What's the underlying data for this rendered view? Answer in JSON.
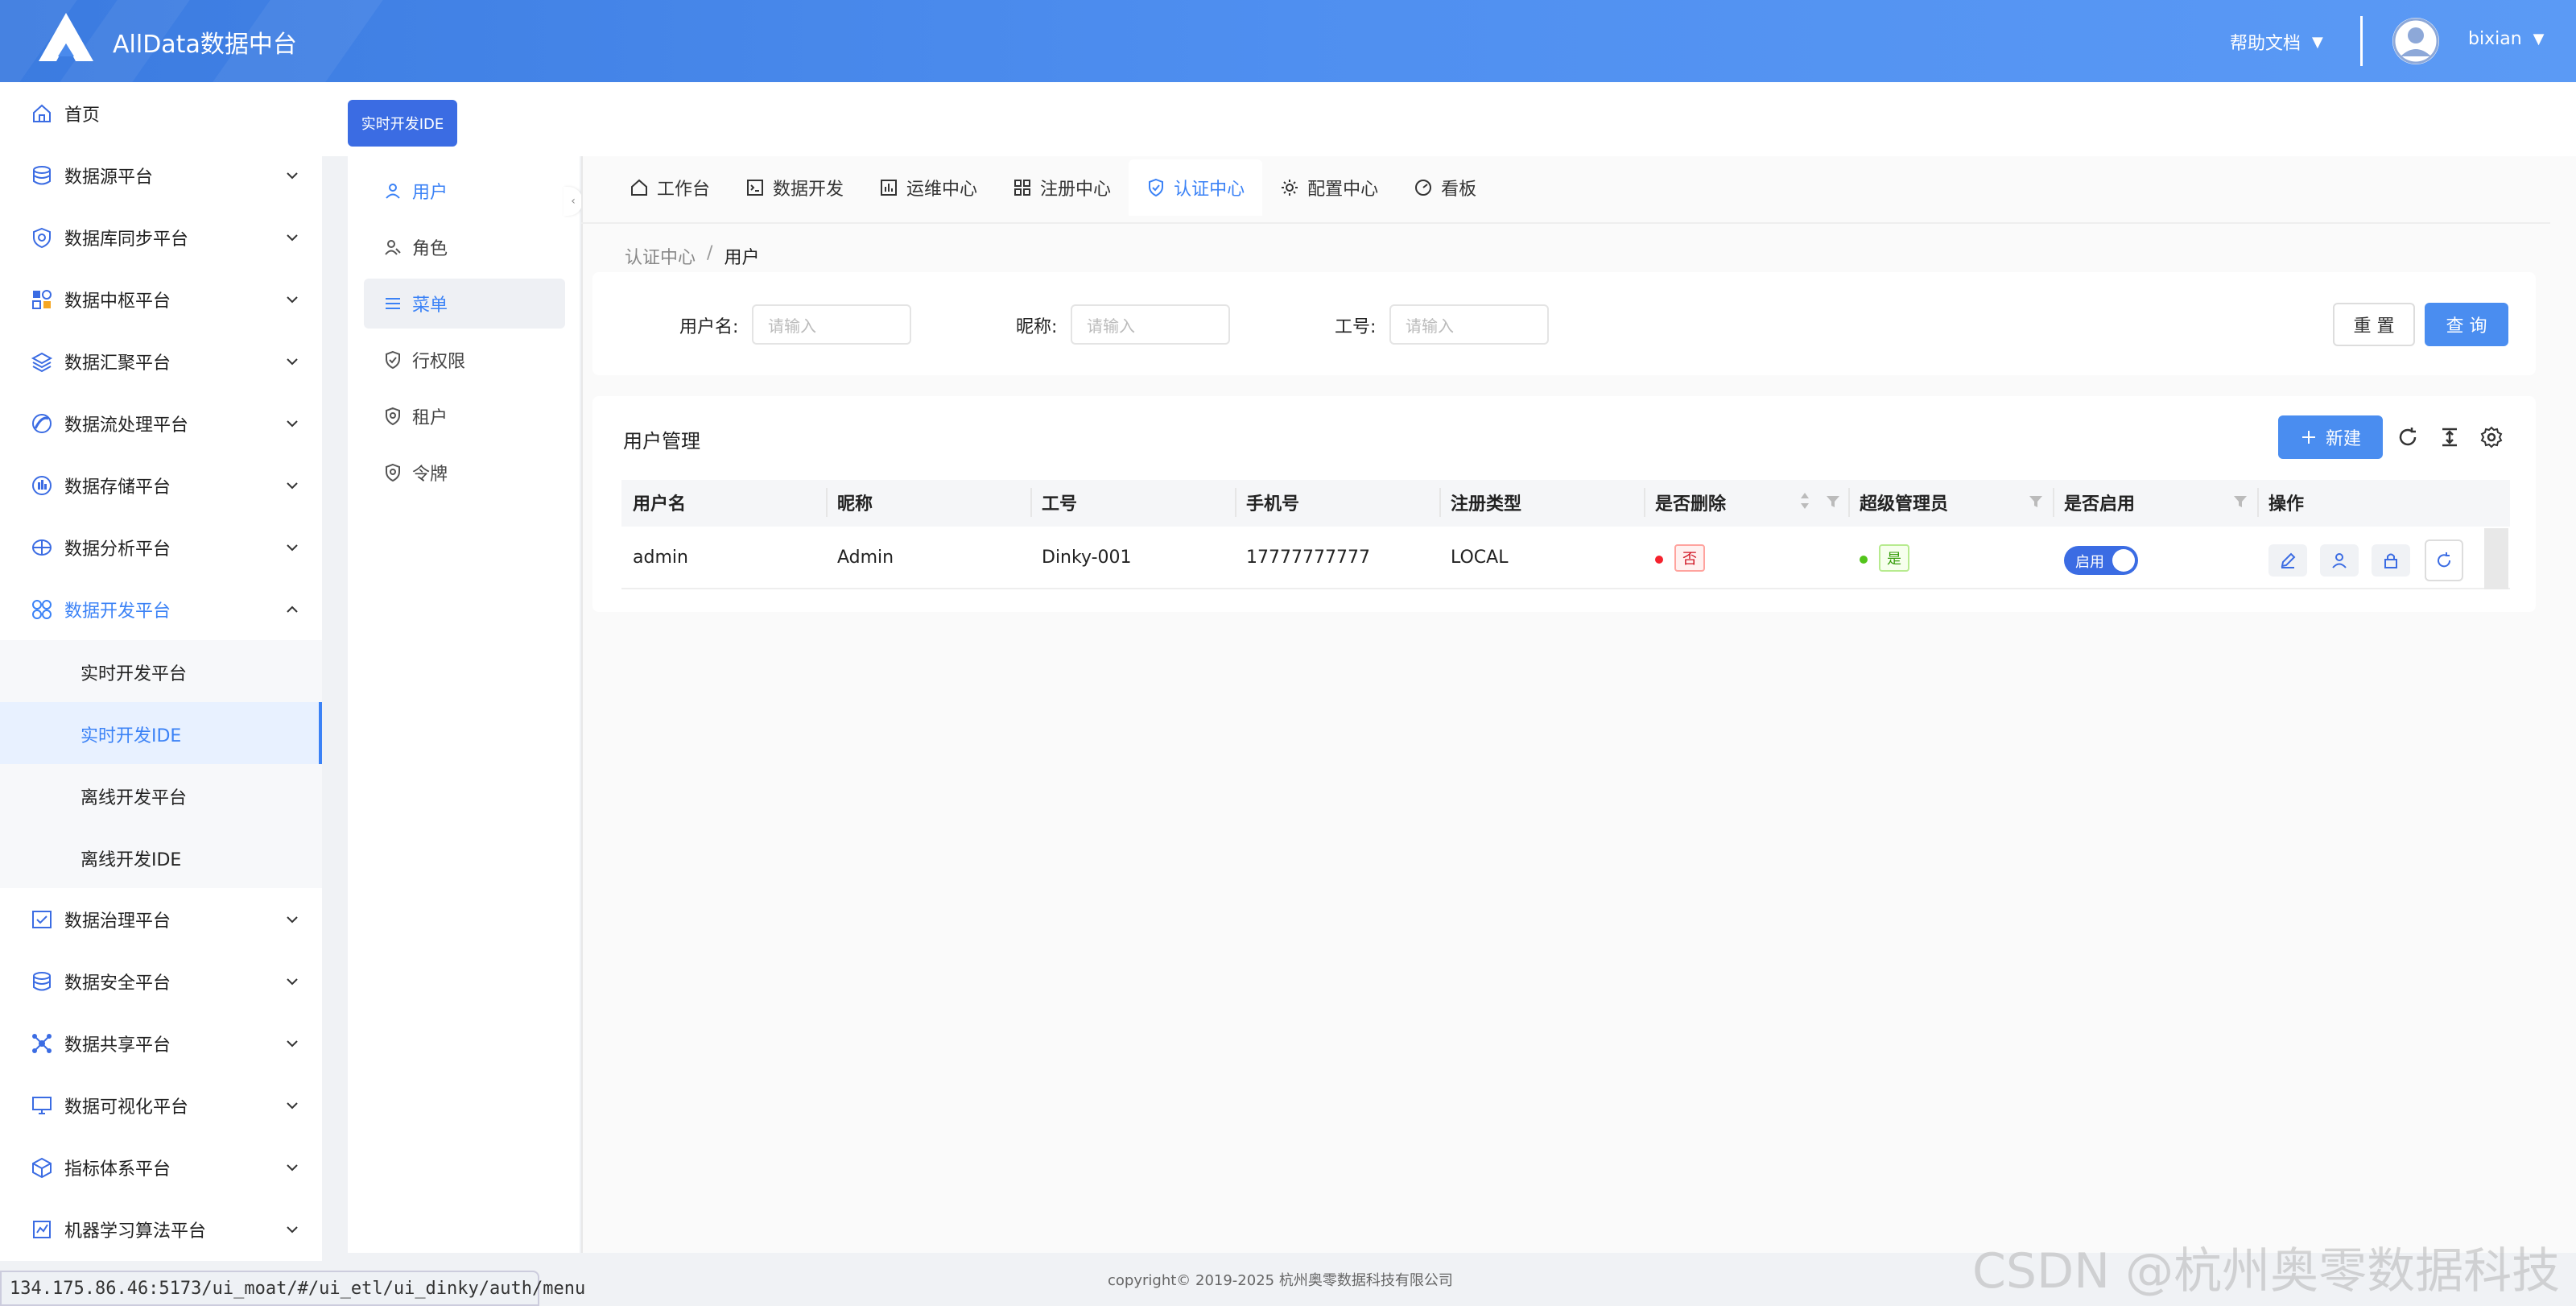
{
  "header": {
    "app_title": "AllData数据中台",
    "help_label": "帮助文档",
    "username": "bixian",
    "caret": "▼",
    "colors": {
      "bar": "#4a8aec",
      "accent": "#3b82f6"
    }
  },
  "sidebar": {
    "items": [
      {
        "label": "首页",
        "icon": "home-icon",
        "chevron": false
      },
      {
        "label": "数据源平台",
        "icon": "database-icon",
        "chevron": "down"
      },
      {
        "label": "数据库同步平台",
        "icon": "sync-shield-icon",
        "chevron": "down"
      },
      {
        "label": "数据中枢平台",
        "icon": "hub-grid-icon",
        "chevron": "down"
      },
      {
        "label": "数据汇聚平台",
        "icon": "layers-icon",
        "chevron": "down"
      },
      {
        "label": "数据流处理平台",
        "icon": "stream-icon",
        "chevron": "down"
      },
      {
        "label": "数据存储平台",
        "icon": "storage-icon",
        "chevron": "down"
      },
      {
        "label": "数据分析平台",
        "icon": "analysis-icon",
        "chevron": "down"
      },
      {
        "label": "数据开发平台",
        "icon": "dev-cluster-icon",
        "chevron": "up"
      }
    ],
    "sub_items": [
      {
        "label": "实时开发平台"
      },
      {
        "label": "实时开发IDE"
      },
      {
        "label": "离线开发平台"
      },
      {
        "label": "离线开发IDE"
      }
    ],
    "items_after": [
      {
        "label": "数据治理平台",
        "icon": "governance-icon"
      },
      {
        "label": "数据安全平台",
        "icon": "security-db-icon"
      },
      {
        "label": "数据共享平台",
        "icon": "share-icon"
      },
      {
        "label": "数据可视化平台",
        "icon": "monitor-icon"
      },
      {
        "label": "指标体系平台",
        "icon": "cube-icon"
      },
      {
        "label": "机器学习算法平台",
        "icon": "ml-icon"
      }
    ]
  },
  "ide_tag": "实时开发IDE",
  "left_panel": {
    "items": [
      {
        "label": "用户",
        "icon": "user-icon"
      },
      {
        "label": "角色",
        "icon": "role-icon"
      },
      {
        "label": "菜单",
        "icon": "menu-icon"
      },
      {
        "label": "行权限",
        "icon": "shield-check-icon"
      },
      {
        "label": "租户",
        "icon": "shield-tenant-icon"
      },
      {
        "label": "令牌",
        "icon": "shield-token-icon"
      }
    ]
  },
  "tabs": [
    {
      "label": "工作台",
      "icon": "home-icon"
    },
    {
      "label": "数据开发",
      "icon": "terminal-icon"
    },
    {
      "label": "运维中心",
      "icon": "ops-chart-icon"
    },
    {
      "label": "注册中心",
      "icon": "grid-icon"
    },
    {
      "label": "认证中心",
      "icon": "shield-check-icon"
    },
    {
      "label": "配置中心",
      "icon": "gear-icon"
    },
    {
      "label": "看板",
      "icon": "dashboard-icon"
    }
  ],
  "breadcrumb": {
    "parent": "认证中心",
    "sep": "/",
    "current": "用户"
  },
  "search": {
    "username_label": "用户名:",
    "nickname_label": "昵称:",
    "worknum_label": "工号:",
    "placeholder": "请输入",
    "reset": "重 置",
    "query": "查 询"
  },
  "table": {
    "title": "用户管理",
    "new_label": "新建",
    "columns": [
      "用户名",
      "昵称",
      "工号",
      "手机号",
      "注册类型",
      "是否删除",
      "超级管理员",
      "是否启用",
      "操作"
    ],
    "rows": [
      {
        "username": "admin",
        "nickname": "Admin",
        "worknum": "Dinky-001",
        "phone": "17777777777",
        "reg_type": "LOCAL",
        "deleted": "否",
        "super_admin": "是",
        "enabled": "启用"
      }
    ]
  },
  "footer": "copyright© 2019-2025 杭州奥零数据科技有限公司",
  "url": "134.175.86.46:5173/ui_moat/#/ui_etl/ui_dinky/auth/menu",
  "watermark": "CSDN @杭州奥零数据科技"
}
